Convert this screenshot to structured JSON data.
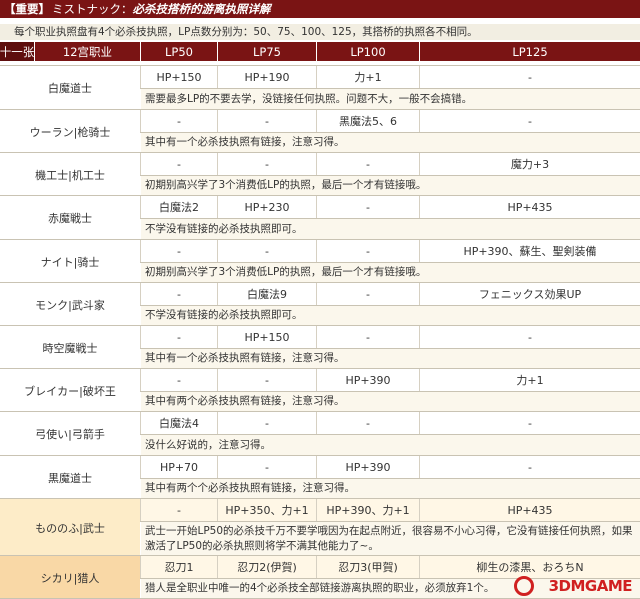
{
  "page": {
    "title_tag": "【重要】",
    "title_prefix": "ミストナック：",
    "title_main": "必杀技搭桥的游离执照详解",
    "subtitle": "每个职业执照盘有4个必杀技执照，LP点数分别为：50、75、100、125，其搭桥的执照各不相同。"
  },
  "colors": {
    "header_bg": "#7a1414",
    "accent_row_bg": "#fdecc8",
    "accent_row_bg2": "#f9d8a6",
    "note_bg": "#fbf7ec",
    "watermark": "#d02020"
  },
  "table": {
    "side_label": "十一张",
    "headers": [
      "12宫职业",
      "LP50",
      "LP75",
      "LP100",
      "LP125"
    ],
    "rows": [
      {
        "job": "白魔道士",
        "values": [
          "HP+150",
          "HP+190",
          "力+1",
          "-"
        ],
        "note": "需要最多LP的不要去学，没链接任何执照。问题不大，一般不会搞错。"
      },
      {
        "job": "ウーラン|枪骑士",
        "values": [
          "-",
          "-",
          "黑魔法5、6",
          "-"
        ],
        "note": "其中有一个必杀技执照有链接，注意习得。"
      },
      {
        "job": "機工士|机工士",
        "values": [
          "-",
          "-",
          "-",
          "魔力+3"
        ],
        "note": "初期别高兴学了3个消费低LP的执照，最后一个才有链接哦。"
      },
      {
        "job": "赤魔戦士",
        "values": [
          "白魔法2",
          "HP+230",
          "-",
          "HP+435"
        ],
        "note": "不学没有链接的必杀技执照即可。"
      },
      {
        "job": "ナイト|骑士",
        "values": [
          "-",
          "-",
          "-",
          "HP+390、蘇生、聖剣装備"
        ],
        "note": "初期别高兴学了3个消费低LP的执照，最后一个才有链接哦。"
      },
      {
        "job": "モンク|武斗家",
        "values": [
          "-",
          "白魔法9",
          "-",
          "フェニックス効果UP"
        ],
        "note": "不学没有链接的必杀技执照即可。"
      },
      {
        "job": "時空魔戦士",
        "values": [
          "-",
          "HP+150",
          "-",
          "-"
        ],
        "note": "其中有一个必杀技执照有链接，注意习得。"
      },
      {
        "job": "ブレイカー|破坏王",
        "values": [
          "-",
          "-",
          "HP+390",
          "力+1"
        ],
        "note": "其中有两个必杀技执照有链接，注意习得。"
      },
      {
        "job": "弓使い|弓箭手",
        "values": [
          "白魔法4",
          "-",
          "-",
          "-"
        ],
        "note": "没什么好说的，注意习得。"
      },
      {
        "job": "黒魔道士",
        "values": [
          "HP+70",
          "-",
          "HP+390",
          "-"
        ],
        "note": "其中有两个个必杀技执照有链接，注意习得。"
      },
      {
        "job": "もののふ|武士",
        "values": [
          "-",
          "HP+350、力+1",
          "HP+390、力+1",
          "HP+435"
        ],
        "note": "武士一开始LP50的必杀技千万不要学哦因为在起点附近，很容易不小心习得，它没有链接任何执照，如果激活了LP50的必杀执照则将学不满其他能力了~。"
      },
      {
        "job": "シカリ|猎人",
        "values": [
          "忍刀1",
          "忍刀2(伊賀)",
          "忍刀3(甲賀)",
          "柳生の漆黒、おろちN"
        ],
        "note": "猎人是全职业中唯一的4个必杀技全部链接游离执照的职业，必须放弃1个。"
      }
    ]
  },
  "watermark": {
    "text": "3DMGAME"
  }
}
